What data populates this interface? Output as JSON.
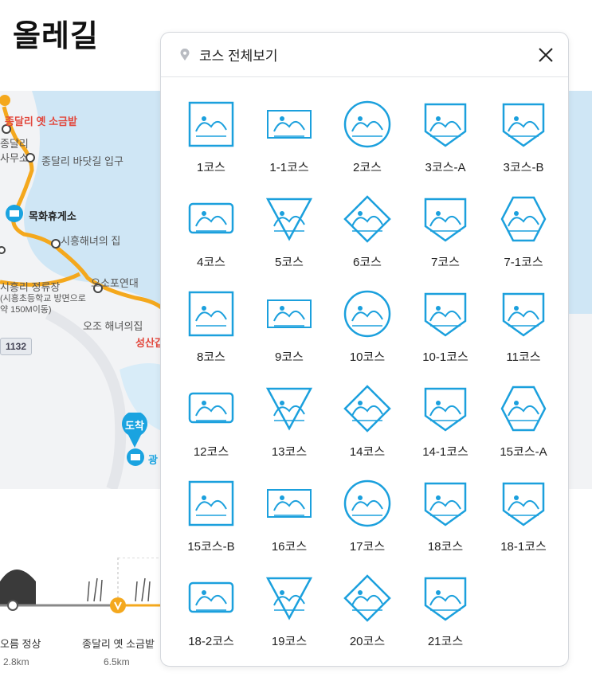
{
  "page": {
    "title": "올레길"
  },
  "map": {
    "labels": {
      "saltpan": "종달리 옛 소금밭",
      "jongdal_frag": "종달리",
      "office_frag": "사무소",
      "bada_entrance": "종달리 바닷길 입구",
      "mokhwa": "목화휴게소",
      "haenyeo_house": "시흥해녀의 집",
      "ososo": "오소포연대",
      "stop": "시흥리 정류장",
      "stop_note1": "(시흥초등학교 방면으로",
      "stop_note2": "약 150M이동)",
      "ojo": "오조 해녀의집",
      "seongsan_frag": "성산갑",
      "road_num": "1132",
      "arrival": "도착",
      "gwang_frag": "광"
    },
    "colors": {
      "route": "#f4a81d",
      "sea": "#cfe6f5",
      "land": "#f2f3f5",
      "accent": "#1aa3e0"
    }
  },
  "elevation": {
    "points": [
      {
        "label": "오름 정상",
        "km": "2.8km"
      },
      {
        "label": "종달리 옛 소금밭",
        "km": "6.5km"
      }
    ]
  },
  "modal": {
    "title": "코스 전체보기",
    "title_icon": "location-pin-icon",
    "close_icon": "close-icon",
    "courses": [
      {
        "label": "1코스",
        "icon": "stamp-icon"
      },
      {
        "label": "1-1코스",
        "icon": "stamp-icon"
      },
      {
        "label": "2코스",
        "icon": "stamp-icon"
      },
      {
        "label": "3코스-A",
        "icon": "stamp-icon"
      },
      {
        "label": "3코스-B",
        "icon": "stamp-icon"
      },
      {
        "label": "4코스",
        "icon": "stamp-icon"
      },
      {
        "label": "5코스",
        "icon": "stamp-icon"
      },
      {
        "label": "6코스",
        "icon": "stamp-icon"
      },
      {
        "label": "7코스",
        "icon": "stamp-icon"
      },
      {
        "label": "7-1코스",
        "icon": "stamp-icon"
      },
      {
        "label": "8코스",
        "icon": "stamp-icon"
      },
      {
        "label": "9코스",
        "icon": "stamp-icon"
      },
      {
        "label": "10코스",
        "icon": "stamp-icon"
      },
      {
        "label": "10-1코스",
        "icon": "stamp-icon"
      },
      {
        "label": "11코스",
        "icon": "stamp-icon"
      },
      {
        "label": "12코스",
        "icon": "stamp-icon"
      },
      {
        "label": "13코스",
        "icon": "stamp-icon"
      },
      {
        "label": "14코스",
        "icon": "stamp-icon"
      },
      {
        "label": "14-1코스",
        "icon": "stamp-icon"
      },
      {
        "label": "15코스-A",
        "icon": "stamp-icon"
      },
      {
        "label": "15코스-B",
        "icon": "stamp-icon"
      },
      {
        "label": "16코스",
        "icon": "stamp-icon"
      },
      {
        "label": "17코스",
        "icon": "stamp-icon"
      },
      {
        "label": "18코스",
        "icon": "stamp-icon"
      },
      {
        "label": "18-1코스",
        "icon": "stamp-icon"
      },
      {
        "label": "18-2코스",
        "icon": "stamp-icon"
      },
      {
        "label": "19코스",
        "icon": "stamp-icon"
      },
      {
        "label": "20코스",
        "icon": "stamp-icon"
      },
      {
        "label": "21코스",
        "icon": "stamp-icon"
      }
    ],
    "stamp_color": "#1ba0dd"
  }
}
